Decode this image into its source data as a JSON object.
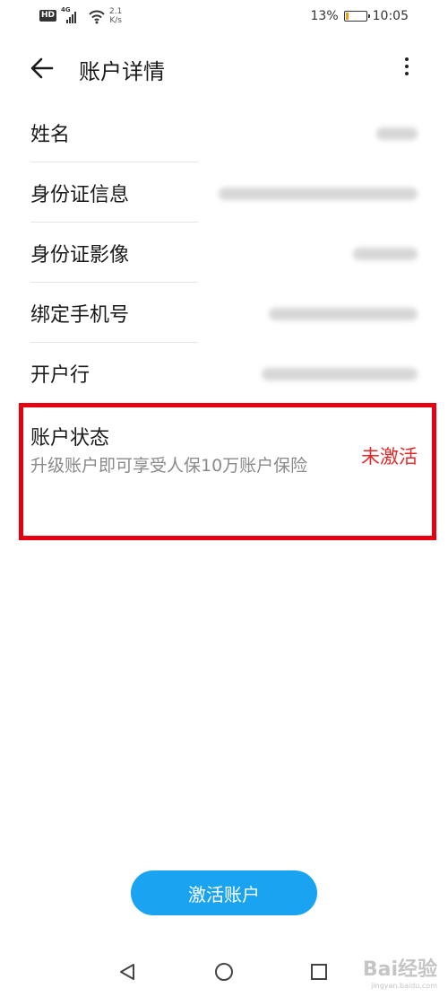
{
  "status_bar": {
    "hd": "HD",
    "network": "4G",
    "speed_value": "2.1",
    "speed_unit": "K/s",
    "battery_percent": "13%",
    "battery_level": 0.13,
    "time": "10:05"
  },
  "header": {
    "title": "账户详情"
  },
  "rows": [
    {
      "label": "姓名"
    },
    {
      "label": "身份证信息"
    },
    {
      "label": "身份证影像"
    },
    {
      "label": "绑定手机号"
    },
    {
      "label": "开户行"
    }
  ],
  "status": {
    "label": "账户状态",
    "description": "升级账户即可享受人保10万账户保险",
    "value": "未激活",
    "highlight_color": "#e60012"
  },
  "actions": {
    "activate_label": "激活账户",
    "button_color": "#1aa3f0"
  },
  "watermark": {
    "main": "Bai经验",
    "sub": "jingyan.baidu.com"
  }
}
